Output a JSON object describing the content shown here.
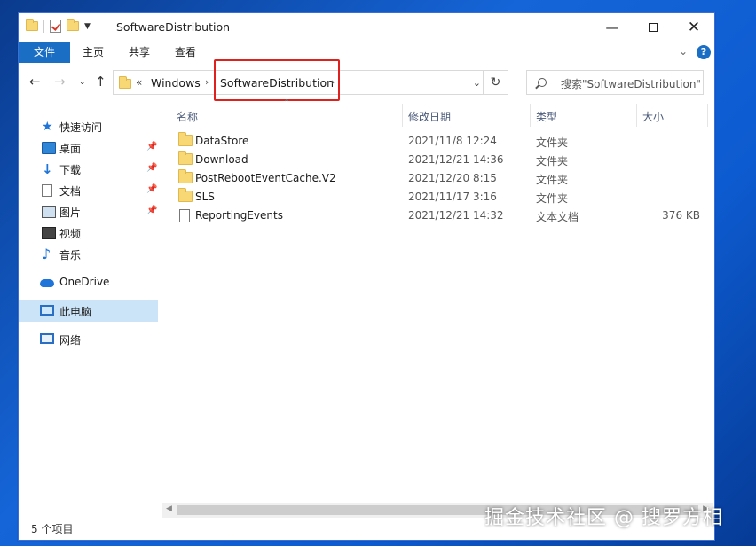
{
  "window": {
    "title": "SoftwareDistribution",
    "controls": {
      "minimize": "—",
      "close": "✕"
    }
  },
  "ribbon": {
    "tabs": [
      "文件",
      "主页",
      "共享",
      "查看"
    ],
    "help": "?"
  },
  "address": {
    "overflow": "«",
    "crumbs": [
      "Windows",
      "SoftwareDistribution"
    ],
    "search_placeholder": "搜索\"SoftwareDistribution\""
  },
  "sidebar": {
    "quick_access": "快速访问",
    "items": [
      {
        "label": "桌面",
        "icon": "desktop-icon",
        "pinned": true
      },
      {
        "label": "下载",
        "icon": "download-icon",
        "pinned": true
      },
      {
        "label": "文档",
        "icon": "document-icon",
        "pinned": true
      },
      {
        "label": "图片",
        "icon": "picture-icon",
        "pinned": true
      },
      {
        "label": "视频",
        "icon": "video-icon",
        "pinned": false
      },
      {
        "label": "音乐",
        "icon": "music-icon",
        "pinned": false
      }
    ],
    "onedrive": "OneDrive",
    "this_pc": "此电脑",
    "network": "网络"
  },
  "columns": {
    "name": "名称",
    "modified": "修改日期",
    "type": "类型",
    "size": "大小"
  },
  "files": [
    {
      "name": "DataStore",
      "modified": "2021/11/8 12:24",
      "type": "文件夹",
      "size": "",
      "kind": "folder"
    },
    {
      "name": "Download",
      "modified": "2021/12/21 14:36",
      "type": "文件夹",
      "size": "",
      "kind": "folder"
    },
    {
      "name": "PostRebootEventCache.V2",
      "modified": "2021/12/20 8:15",
      "type": "文件夹",
      "size": "",
      "kind": "folder"
    },
    {
      "name": "SLS",
      "modified": "2021/11/17 3:16",
      "type": "文件夹",
      "size": "",
      "kind": "folder"
    },
    {
      "name": "ReportingEvents",
      "modified": "2021/12/21 14:32",
      "type": "文本文档",
      "size": "376 KB",
      "kind": "file"
    }
  ],
  "status": {
    "count": "5 个项目"
  },
  "watermark": "掘金技术社区 @ 搜罗方相",
  "colors": {
    "accent": "#1a6ec4",
    "highlight": "#e0201c",
    "selected": "#cce4f7"
  }
}
